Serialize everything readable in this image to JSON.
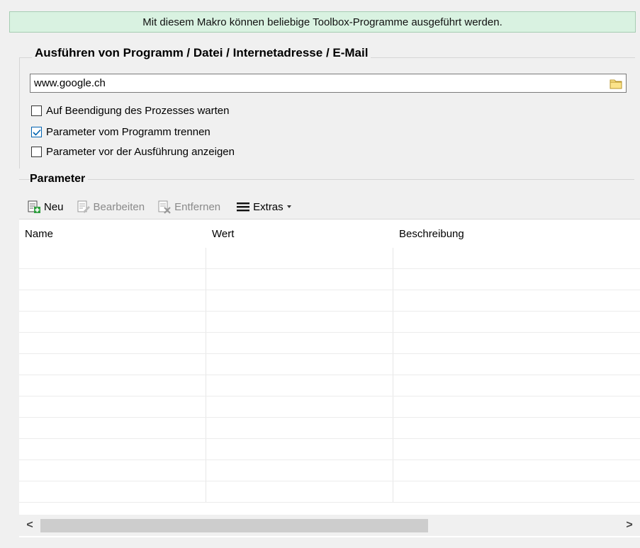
{
  "banner": {
    "text": "Mit diesem Makro können beliebige Toolbox-Programme ausgeführt werden."
  },
  "exec_group": {
    "title": "Ausführen von Programm / Datei / Internetadresse / E-Mail",
    "path_value": "www.google.ch",
    "options": [
      {
        "label": "Auf Beendigung des Prozesses warten",
        "checked": false
      },
      {
        "label": "Parameter vom Programm trennen",
        "checked": true
      },
      {
        "label": "Parameter vor der Ausführung anzeigen",
        "checked": false
      }
    ]
  },
  "params": {
    "title": "Parameter",
    "toolbar": {
      "new_label": "Neu",
      "edit_label": "Bearbeiten",
      "remove_label": "Entfernen",
      "extras_label": "Extras"
    },
    "columns": [
      "Name",
      "Wert",
      "Beschreibung"
    ],
    "rows": []
  },
  "scrollbar": {
    "left_arrow": "<",
    "right_arrow": ">",
    "thumb_fraction": 0.67
  },
  "colors": {
    "banner_bg": "#d9f2e1",
    "check_accent": "#0063b1"
  }
}
